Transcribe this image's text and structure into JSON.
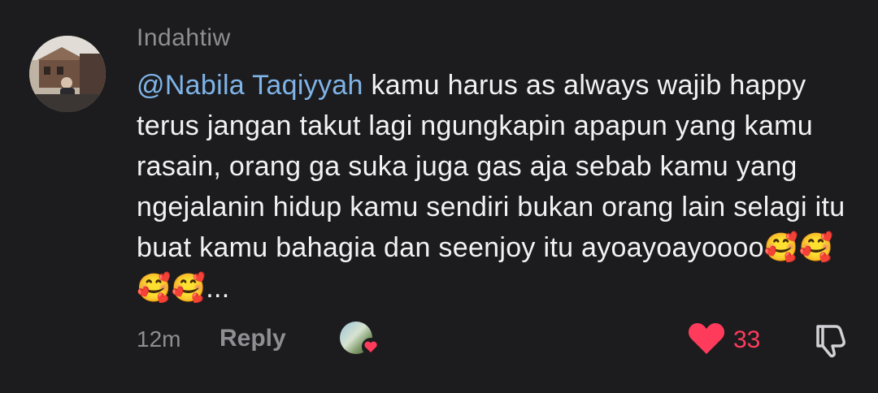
{
  "comment": {
    "username": "Indahtiw",
    "mention": "@Nabila Taqiyyah",
    "text": " kamu harus as always wajib happy terus jangan takut lagi ngungkapin apapun yang kamu rasain, orang ga suka juga gas aja sebab kamu yang ngejalanin hidup kamu sendiri bukan orang lain selagi itu buat kamu bahagia dan seenjoy itu ayoayoayoooo🥰🥰🥰🥰...",
    "timestamp": "12m",
    "reply_label": "Reply",
    "like_count": "33",
    "liked": true
  },
  "icons": {
    "avatar": "user-avatar",
    "creator_liked": "creator-avatar-with-heart",
    "like": "heart-icon",
    "dislike": "thumbs-down-icon"
  },
  "colors": {
    "background": "#1c1c1e",
    "mention": "#7fb4e8",
    "like": "#ff3b5c",
    "muted": "#8e8e93"
  }
}
